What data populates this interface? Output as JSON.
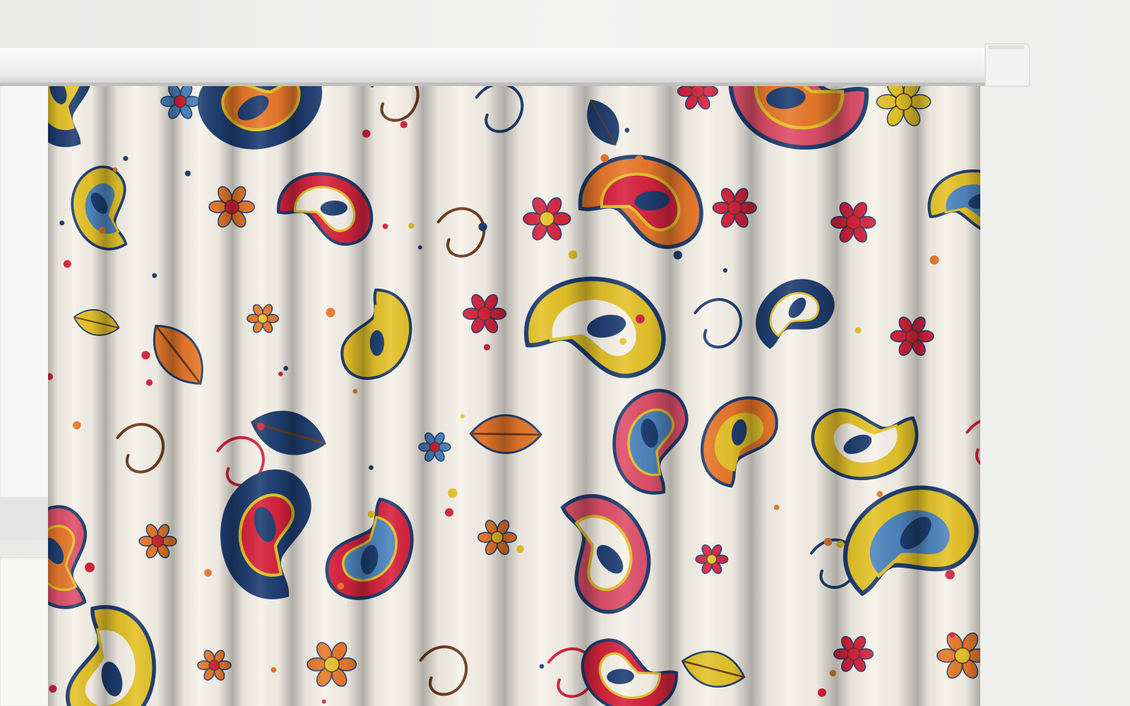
{
  "scene": {
    "subject": "paisley-curtain-on-track",
    "colors": {
      "wall": "#f1f1f0",
      "wall_shadow": "#e2e2e1",
      "track": "#f4f4f4",
      "track_shadow": "#c9c9c9",
      "fabric": "#f7f3ea",
      "navy": "#1f3f72",
      "red": "#d8243f",
      "orange": "#e9792b",
      "yellow": "#e6c42a",
      "brown": "#6b3a1e",
      "blue": "#4f86c0",
      "pink": "#e0506a"
    }
  }
}
